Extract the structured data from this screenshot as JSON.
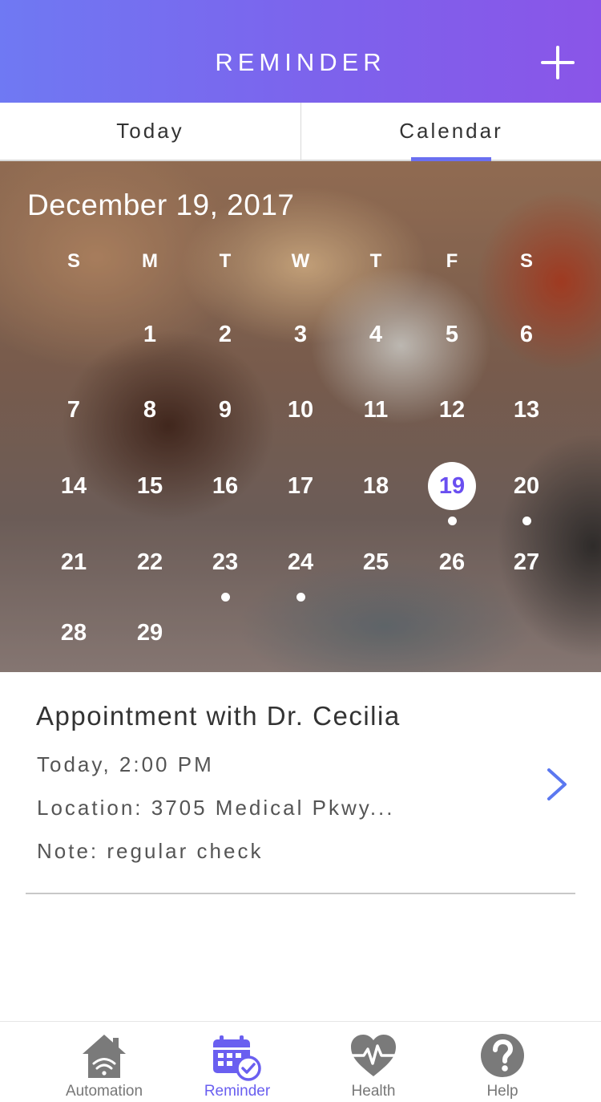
{
  "header": {
    "title": "REMINDER",
    "add_icon": "plus-icon",
    "gradient_colors": [
      "#6f79f3",
      "#8a55e8"
    ]
  },
  "tabs": [
    {
      "label": "Today",
      "active": false
    },
    {
      "label": "Calendar",
      "active": true
    }
  ],
  "calendar": {
    "date_heading": "December 19, 2017",
    "weekdays": [
      "S",
      "M",
      "T",
      "W",
      "T",
      "F",
      "S"
    ],
    "days": [
      "1",
      "2",
      "3",
      "4",
      "5",
      "6",
      "7",
      "8",
      "9",
      "10",
      "11",
      "12",
      "13",
      "14",
      "15",
      "16",
      "17",
      "18",
      "19",
      "20",
      "21",
      "22",
      "23",
      "24",
      "25",
      "26",
      "27",
      "28",
      "29"
    ],
    "selected_day": "19",
    "days_with_events": [
      "19",
      "20",
      "23",
      "24"
    ],
    "accent_color": "#6a4ff0"
  },
  "appointment": {
    "title": "Appointment with Dr. Cecilia",
    "time": "Today, 2:00 PM",
    "location": "Location: 3705 Medical Pkwy...",
    "note": "Note: regular check",
    "chevron_icon": "chevron-right-icon"
  },
  "bottom_nav": {
    "items": [
      {
        "label": "Automation",
        "icon": "home-wifi-icon",
        "active": false
      },
      {
        "label": "Reminder",
        "icon": "calendar-check-icon",
        "active": true
      },
      {
        "label": "Health",
        "icon": "heart-pulse-icon",
        "active": false
      },
      {
        "label": "Help",
        "icon": "question-icon",
        "active": false
      }
    ],
    "active_color": "#6a5ff0",
    "inactive_color": "#777777"
  }
}
